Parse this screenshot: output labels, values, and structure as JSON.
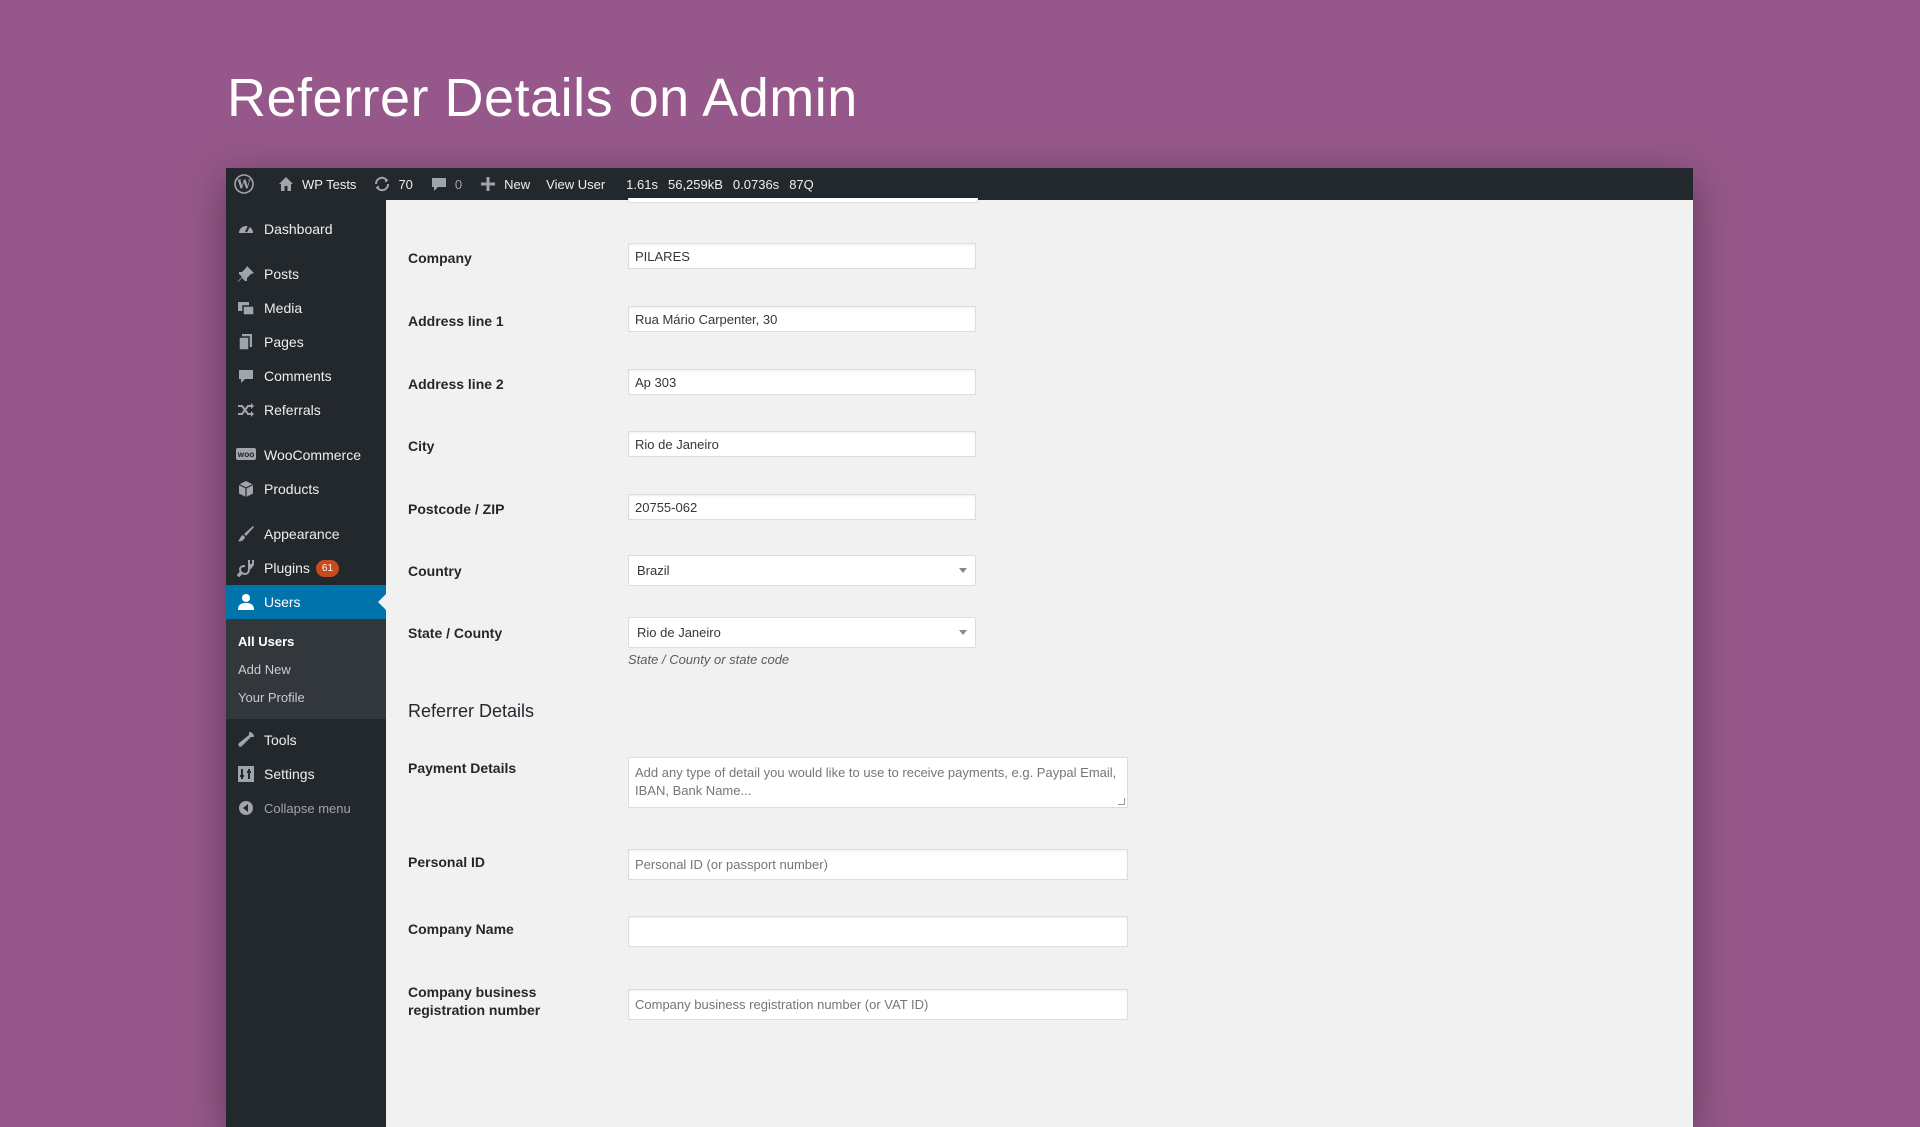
{
  "headline": "Referrer Details on Admin",
  "adminbar": {
    "site_name": "WP Tests",
    "updates_count": "70",
    "comments_count": "0",
    "new_label": "New",
    "view_user_label": "View User",
    "stats": [
      "1.61s",
      "56,259kB",
      "0.0736s",
      "87Q"
    ]
  },
  "sidebar": {
    "items": {
      "dashboard": "Dashboard",
      "posts": "Posts",
      "media": "Media",
      "pages": "Pages",
      "comments": "Comments",
      "referrals": "Referrals",
      "woocommerce": "WooCommerce",
      "products": "Products",
      "appearance": "Appearance",
      "plugins": "Plugins",
      "plugins_badge": "61",
      "users": "Users",
      "tools": "Tools",
      "settings": "Settings",
      "collapse": "Collapse menu"
    },
    "users_submenu": [
      "All Users",
      "Add New",
      "Your Profile"
    ]
  },
  "form": {
    "company": {
      "label": "Company",
      "value": "PILARES"
    },
    "address1": {
      "label": "Address line 1",
      "value": "Rua Mário Carpenter, 30"
    },
    "address2": {
      "label": "Address line 2",
      "value": "Ap 303"
    },
    "city": {
      "label": "City",
      "value": "Rio de Janeiro"
    },
    "postcode": {
      "label": "Postcode / ZIP",
      "value": "20755-062"
    },
    "country": {
      "label": "Country",
      "value": "Brazil"
    },
    "state": {
      "label": "State / County",
      "value": "Rio de Janeiro",
      "description": "State / County or state code"
    }
  },
  "referrer": {
    "title": "Referrer Details",
    "payment_details": {
      "label": "Payment Details",
      "placeholder": "Add any type of detail you would like to use to receive payments, e.g. Paypal Email, IBAN, Bank Name..."
    },
    "personal_id": {
      "label": "Personal ID",
      "placeholder": "Personal ID (or passport number)"
    },
    "company_name": {
      "label": "Company Name",
      "value": ""
    },
    "company_reg": {
      "label": "Company business registration number",
      "placeholder": "Company business registration number (or VAT ID)"
    }
  },
  "colors": {
    "background": "#96588a",
    "adminbar": "#23282d",
    "menu_active": "#0073aa",
    "badge": "#ca4a1f"
  }
}
